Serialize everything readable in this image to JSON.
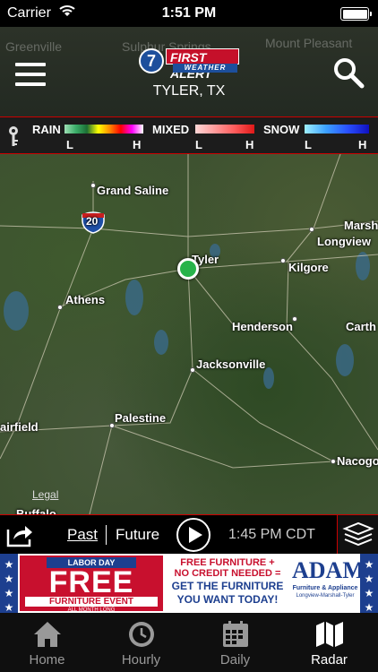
{
  "status_bar": {
    "carrier": "Carrier",
    "time": "1:51 PM"
  },
  "header": {
    "logo": {
      "number": "7",
      "first_alert": "FIRST ALERT",
      "weather": "WEATHER"
    },
    "location": "TYLER, TX",
    "map_labels": [
      "Greenville",
      "Sulphur Springs",
      "Mount Pleasant"
    ]
  },
  "legend": {
    "rain": {
      "label": "RAIN",
      "low": "L",
      "high": "H"
    },
    "mixed": {
      "label": "MIXED",
      "low": "L",
      "high": "H"
    },
    "snow": {
      "label": "SNOW",
      "low": "L",
      "high": "H"
    }
  },
  "map": {
    "highway_shield": "20",
    "cities": [
      {
        "name": "Grand Saline"
      },
      {
        "name": "Marsh"
      },
      {
        "name": "Longview"
      },
      {
        "name": "Tyler"
      },
      {
        "name": "Kilgore"
      },
      {
        "name": "Athens"
      },
      {
        "name": "Henderson"
      },
      {
        "name": "Carth"
      },
      {
        "name": "Jacksonville"
      },
      {
        "name": "Palestine"
      },
      {
        "name": "airfield"
      },
      {
        "name": "Nacogo"
      },
      {
        "name": "Buffalo"
      }
    ],
    "legal_link": "Legal"
  },
  "playback": {
    "past": "Past",
    "future": "Future",
    "timestamp": "1:45 PM CDT"
  },
  "ad": {
    "top": "LABOR DAY",
    "big": "FREE",
    "sub": "FURNITURE EVENT",
    "month": "ALL MONTH LONG",
    "mid_line1": "FREE FURNITURE +",
    "mid_line2": "NO CREDIT NEEDED =",
    "mid_line3": "GET THE FURNITURE",
    "mid_line4": "YOU WANT TODAY!",
    "brand": "ADAMS",
    "brand_sub": "Furniture & Appliance",
    "brand_loc": "Longview-Marshall-Tyler"
  },
  "tabs": [
    {
      "label": "Home",
      "icon": "home-icon"
    },
    {
      "label": "Hourly",
      "icon": "clock-icon"
    },
    {
      "label": "Daily",
      "icon": "calendar-icon"
    },
    {
      "label": "Radar",
      "icon": "map-icon"
    }
  ],
  "active_tab": "Radar",
  "colors": {
    "accent_red": "#cc0000",
    "marker_green": "#27b34a",
    "tab_active": "#ffffff",
    "tab_inactive": "#999999"
  }
}
